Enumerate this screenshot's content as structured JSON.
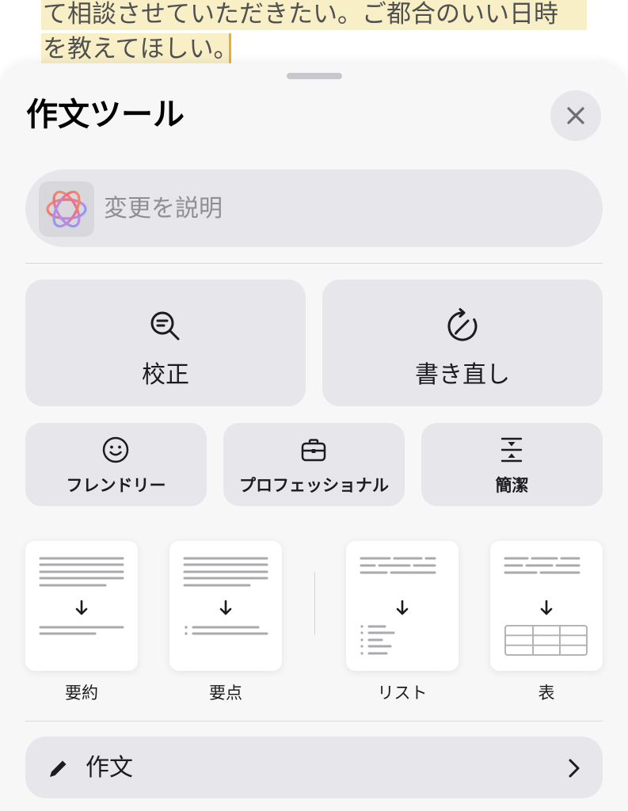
{
  "document": {
    "lines": [
      "て相談させていただきたい。ご都合のいい日時",
      "を教えてほしい。"
    ]
  },
  "sheet": {
    "title": "作文ツール",
    "close_icon": "close-icon",
    "describe_input": {
      "placeholder": "変更を説明",
      "icon": "apple-intelligence-icon"
    },
    "primary_tools": [
      {
        "label": "校正",
        "icon": "proofread-icon"
      },
      {
        "label": "書き直し",
        "icon": "rewrite-icon"
      }
    ],
    "tone_tools": [
      {
        "label": "フレンドリー",
        "icon": "smiley-icon"
      },
      {
        "label": "プロフェッショナル",
        "icon": "briefcase-icon"
      },
      {
        "label": "簡潔",
        "icon": "concise-icon"
      }
    ],
    "format_tools": [
      {
        "label": "要約",
        "icon": "summary-icon"
      },
      {
        "label": "要点",
        "icon": "key-points-icon"
      },
      {
        "label": "リスト",
        "icon": "list-icon"
      },
      {
        "label": "表",
        "icon": "table-icon"
      }
    ],
    "compose": {
      "label": "作文",
      "icon": "pencil-icon",
      "chevron": "chevron-right-icon"
    }
  },
  "colors": {
    "highlight": "#f8efc7",
    "cursor": "#e4b03c",
    "sheet_bg": "#f7f7f7",
    "button_bg": "#e6e6eb"
  }
}
